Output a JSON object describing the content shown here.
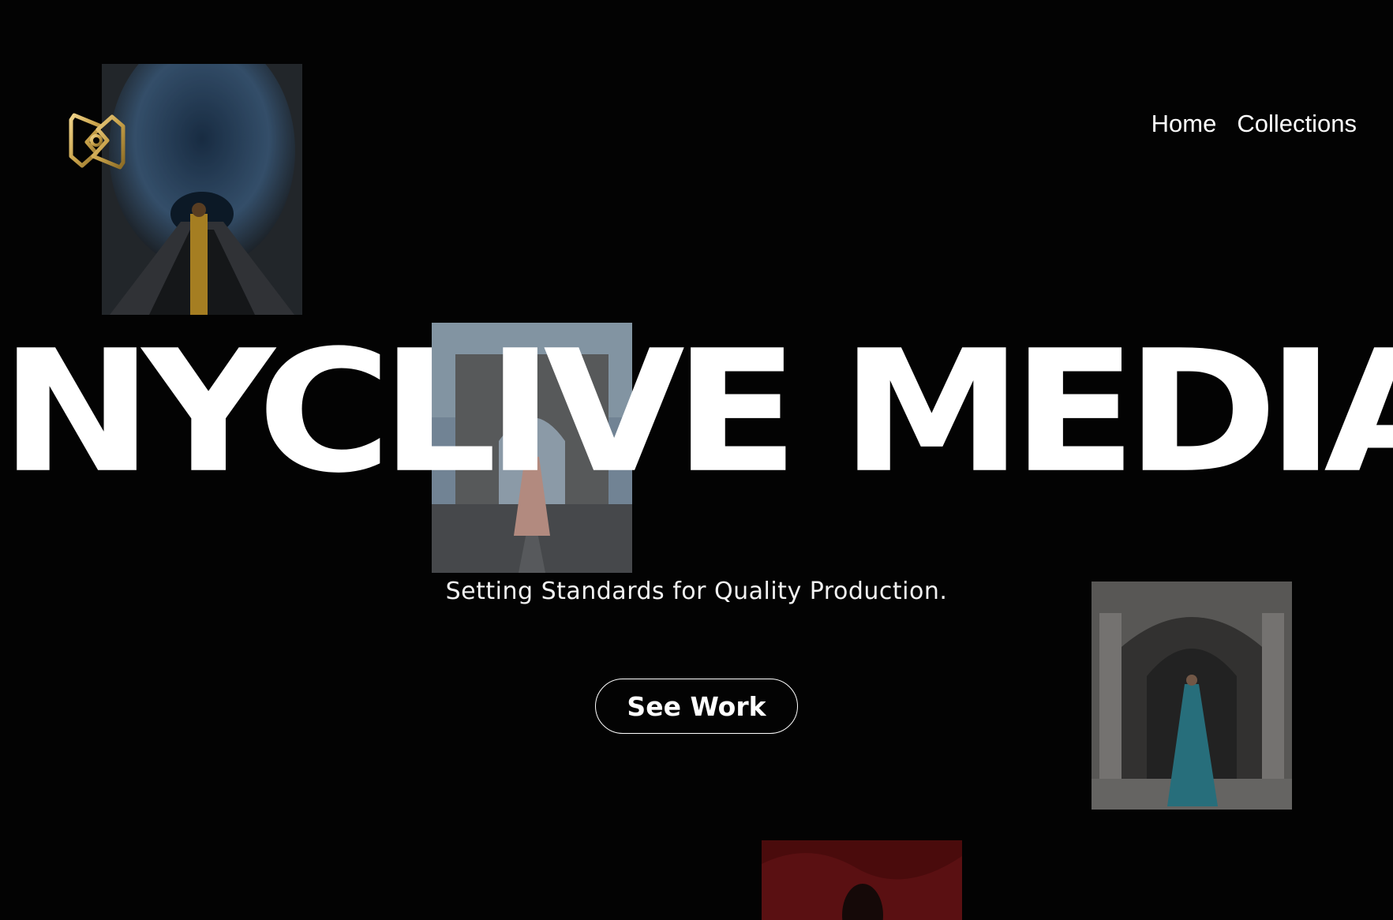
{
  "nav": {
    "items": [
      {
        "label": "Home"
      },
      {
        "label": "Collections"
      }
    ]
  },
  "hero": {
    "title": "NYCLIVE MEDIA",
    "tagline": "Setting Standards for Quality Production.",
    "cta_label": "See Work"
  },
  "colors": {
    "background": "#030303",
    "text": "#ffffff",
    "logo_gold": "#c9a24a"
  },
  "icons": {
    "logo": "nyclive-logo-icon"
  }
}
